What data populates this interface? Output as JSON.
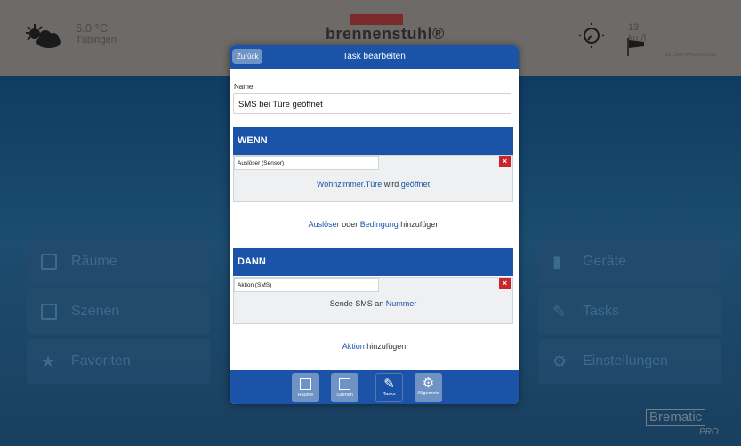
{
  "weather": {
    "temperature": "6.0 °C",
    "city": "Tübingen",
    "icon": "sun-cloud-icon"
  },
  "logo": {
    "text": "brennenstuhl®"
  },
  "wind": {
    "speed": "13 km/h",
    "source": "by OpenWeatherMap",
    "icon": "compass-icon"
  },
  "tiles": {
    "left": [
      {
        "label": "Räume",
        "icon": "rooms-icon"
      },
      {
        "label": "Szenen",
        "icon": "play-icon"
      },
      {
        "label": "Favoriten",
        "icon": "star-icon"
      }
    ],
    "right": [
      {
        "label": "Geräte",
        "icon": "plug-icon"
      },
      {
        "label": "Tasks",
        "icon": "tasks-icon"
      },
      {
        "label": "Einstellungen",
        "icon": "gear-icon"
      }
    ]
  },
  "brand": {
    "line1": "Brematic",
    "line2": "PRO"
  },
  "modal": {
    "title": "Task bearbeiten",
    "back_label": "Zurück",
    "name_label": "Name",
    "name_value": "SMS bei Türe geöffnet",
    "when": {
      "header": "WENN",
      "select": "Auslöser (Sensor)",
      "remove": "×",
      "device": "Wohnzimmer.Türe",
      "middle": "wird",
      "state": "geöffnet",
      "add_trigger": "Auslöser",
      "add_or": "oder",
      "add_condition": "Bedingung",
      "add_suffix": "hinzufügen"
    },
    "then": {
      "header": "DANN",
      "select": "Aktion (SMS)",
      "remove": "×",
      "text": "Sende SMS an",
      "target": "Nummer",
      "add_action": "Aktion",
      "add_suffix": "hinzufügen"
    },
    "footer": [
      {
        "label": "Räume",
        "icon": "rooms-icon",
        "active": false
      },
      {
        "label": "Szenen",
        "icon": "play-icon",
        "active": false
      },
      {
        "label": "Tasks",
        "icon": "tasks-icon",
        "active": true
      },
      {
        "label": "Allgemein",
        "icon": "gear-icon",
        "active": false
      }
    ]
  }
}
